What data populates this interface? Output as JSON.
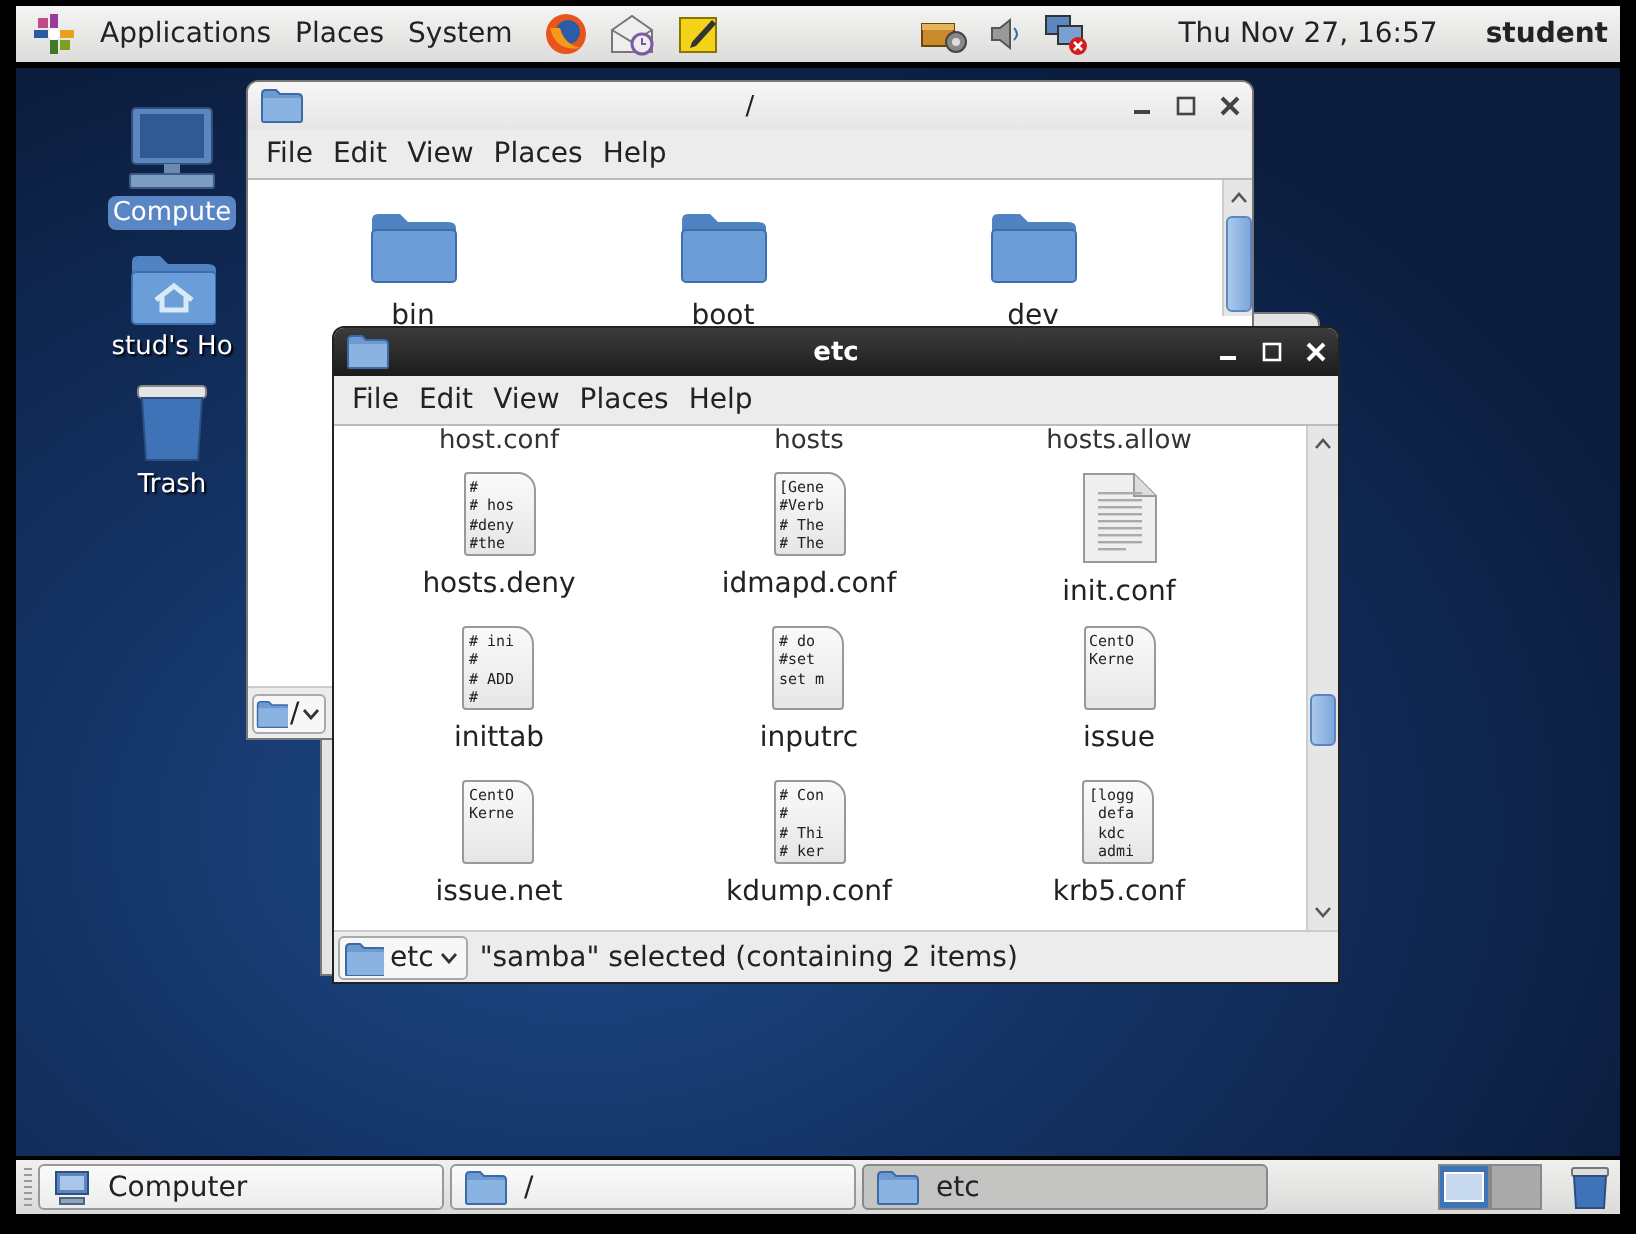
{
  "top_panel": {
    "menus": [
      "Applications",
      "Places",
      "System"
    ],
    "clock": "Thu Nov 27, 16:57",
    "user": "student"
  },
  "desktop_icons": [
    {
      "label": "Compute",
      "kind": "computer",
      "selected": true
    },
    {
      "label": "stud's Ho",
      "kind": "home",
      "selected": false
    },
    {
      "label": "Trash",
      "kind": "trash",
      "selected": false
    }
  ],
  "windows": [
    {
      "title": "/",
      "active": false,
      "menus": [
        "File",
        "Edit",
        "View",
        "Places",
        "Help"
      ],
      "items": [
        {
          "name": "bin",
          "kind": "folder"
        },
        {
          "name": "boot",
          "kind": "folder"
        },
        {
          "name": "dev",
          "kind": "folder"
        }
      ],
      "location": "/"
    },
    {
      "title": "etc",
      "active": true,
      "menus": [
        "File",
        "Edit",
        "View",
        "Places",
        "Help"
      ],
      "partial_row": [
        "host.conf",
        "hosts",
        "hosts.allow"
      ],
      "items": [
        {
          "name": "hosts.deny",
          "kind": "text",
          "preview": [
            "#",
            "# hos",
            "#deny",
            "#the"
          ]
        },
        {
          "name": "idmapd.conf",
          "kind": "text",
          "preview": [
            "[Gene",
            "#Verb",
            "# The",
            "# The"
          ]
        },
        {
          "name": "init.conf",
          "kind": "plain"
        },
        {
          "name": "inittab",
          "kind": "text",
          "preview": [
            "# ini",
            "#",
            "# ADD",
            "#"
          ]
        },
        {
          "name": "inputrc",
          "kind": "text",
          "preview": [
            "# do",
            "#set",
            "set m"
          ]
        },
        {
          "name": "issue",
          "kind": "text",
          "preview": [
            "CentO",
            "Kerne"
          ]
        },
        {
          "name": "issue.net",
          "kind": "text",
          "preview": [
            "CentO",
            "Kerne"
          ]
        },
        {
          "name": "kdump.conf",
          "kind": "text",
          "preview": [
            "# Con",
            "#",
            "# Thi",
            "# ker"
          ]
        },
        {
          "name": "krb5.conf",
          "kind": "text",
          "preview": [
            "[logg",
            " defa",
            " kdc",
            " admi"
          ]
        }
      ],
      "location": "etc",
      "status": "\"samba\" selected (containing 2 items)"
    }
  ],
  "taskbar": [
    {
      "label": "Computer",
      "kind": "computer",
      "selected": false
    },
    {
      "label": "/",
      "kind": "folder",
      "selected": false
    },
    {
      "label": "etc",
      "kind": "folder",
      "selected": true
    }
  ],
  "workspaces": [
    {
      "selected": true
    },
    {
      "selected": false
    }
  ]
}
